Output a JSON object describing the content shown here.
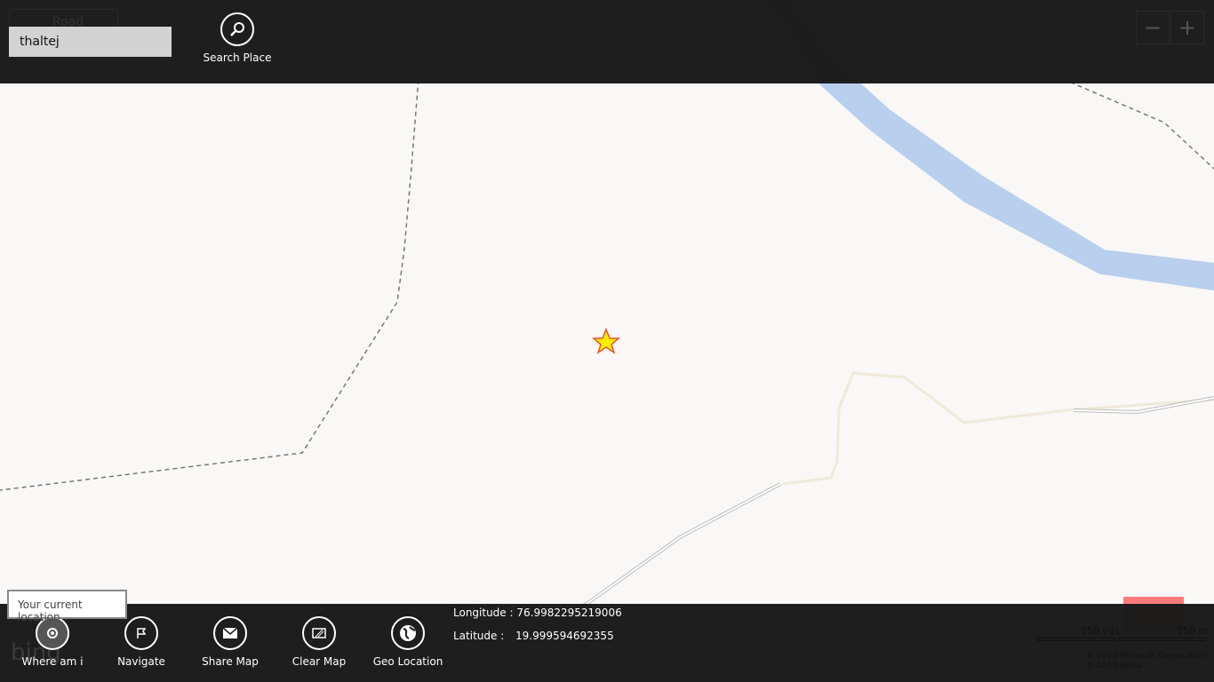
{
  "search": {
    "value": "thaltej",
    "button_label": "Search Place",
    "map_style": "Road"
  },
  "zoom": {
    "out": "−",
    "in": "+"
  },
  "appbar": {
    "buttons": [
      {
        "label": "Where am i",
        "icon": "target-icon"
      },
      {
        "label": "Navigate",
        "icon": "flag-icon"
      },
      {
        "label": "Share Map",
        "icon": "mail-icon"
      },
      {
        "label": "Clear Map",
        "icon": "clear-icon"
      },
      {
        "label": "Geo Location",
        "icon": "globe-icon"
      }
    ]
  },
  "tooltip": "Your current location",
  "coords": {
    "longitude_label": "Longitude :",
    "longitude": "76.9982295219006",
    "latitude_label": "Latitude :",
    "latitude": "19.999594692355"
  },
  "map": {
    "scale_imperial": "250 yds",
    "scale_metric": "250 m",
    "copyright": [
      "© 2013 Microsoft Corporation",
      "© 2013 Nokia"
    ],
    "logo": "bing",
    "marker_color": "#ffee00",
    "water_color": "#b8cfee"
  }
}
